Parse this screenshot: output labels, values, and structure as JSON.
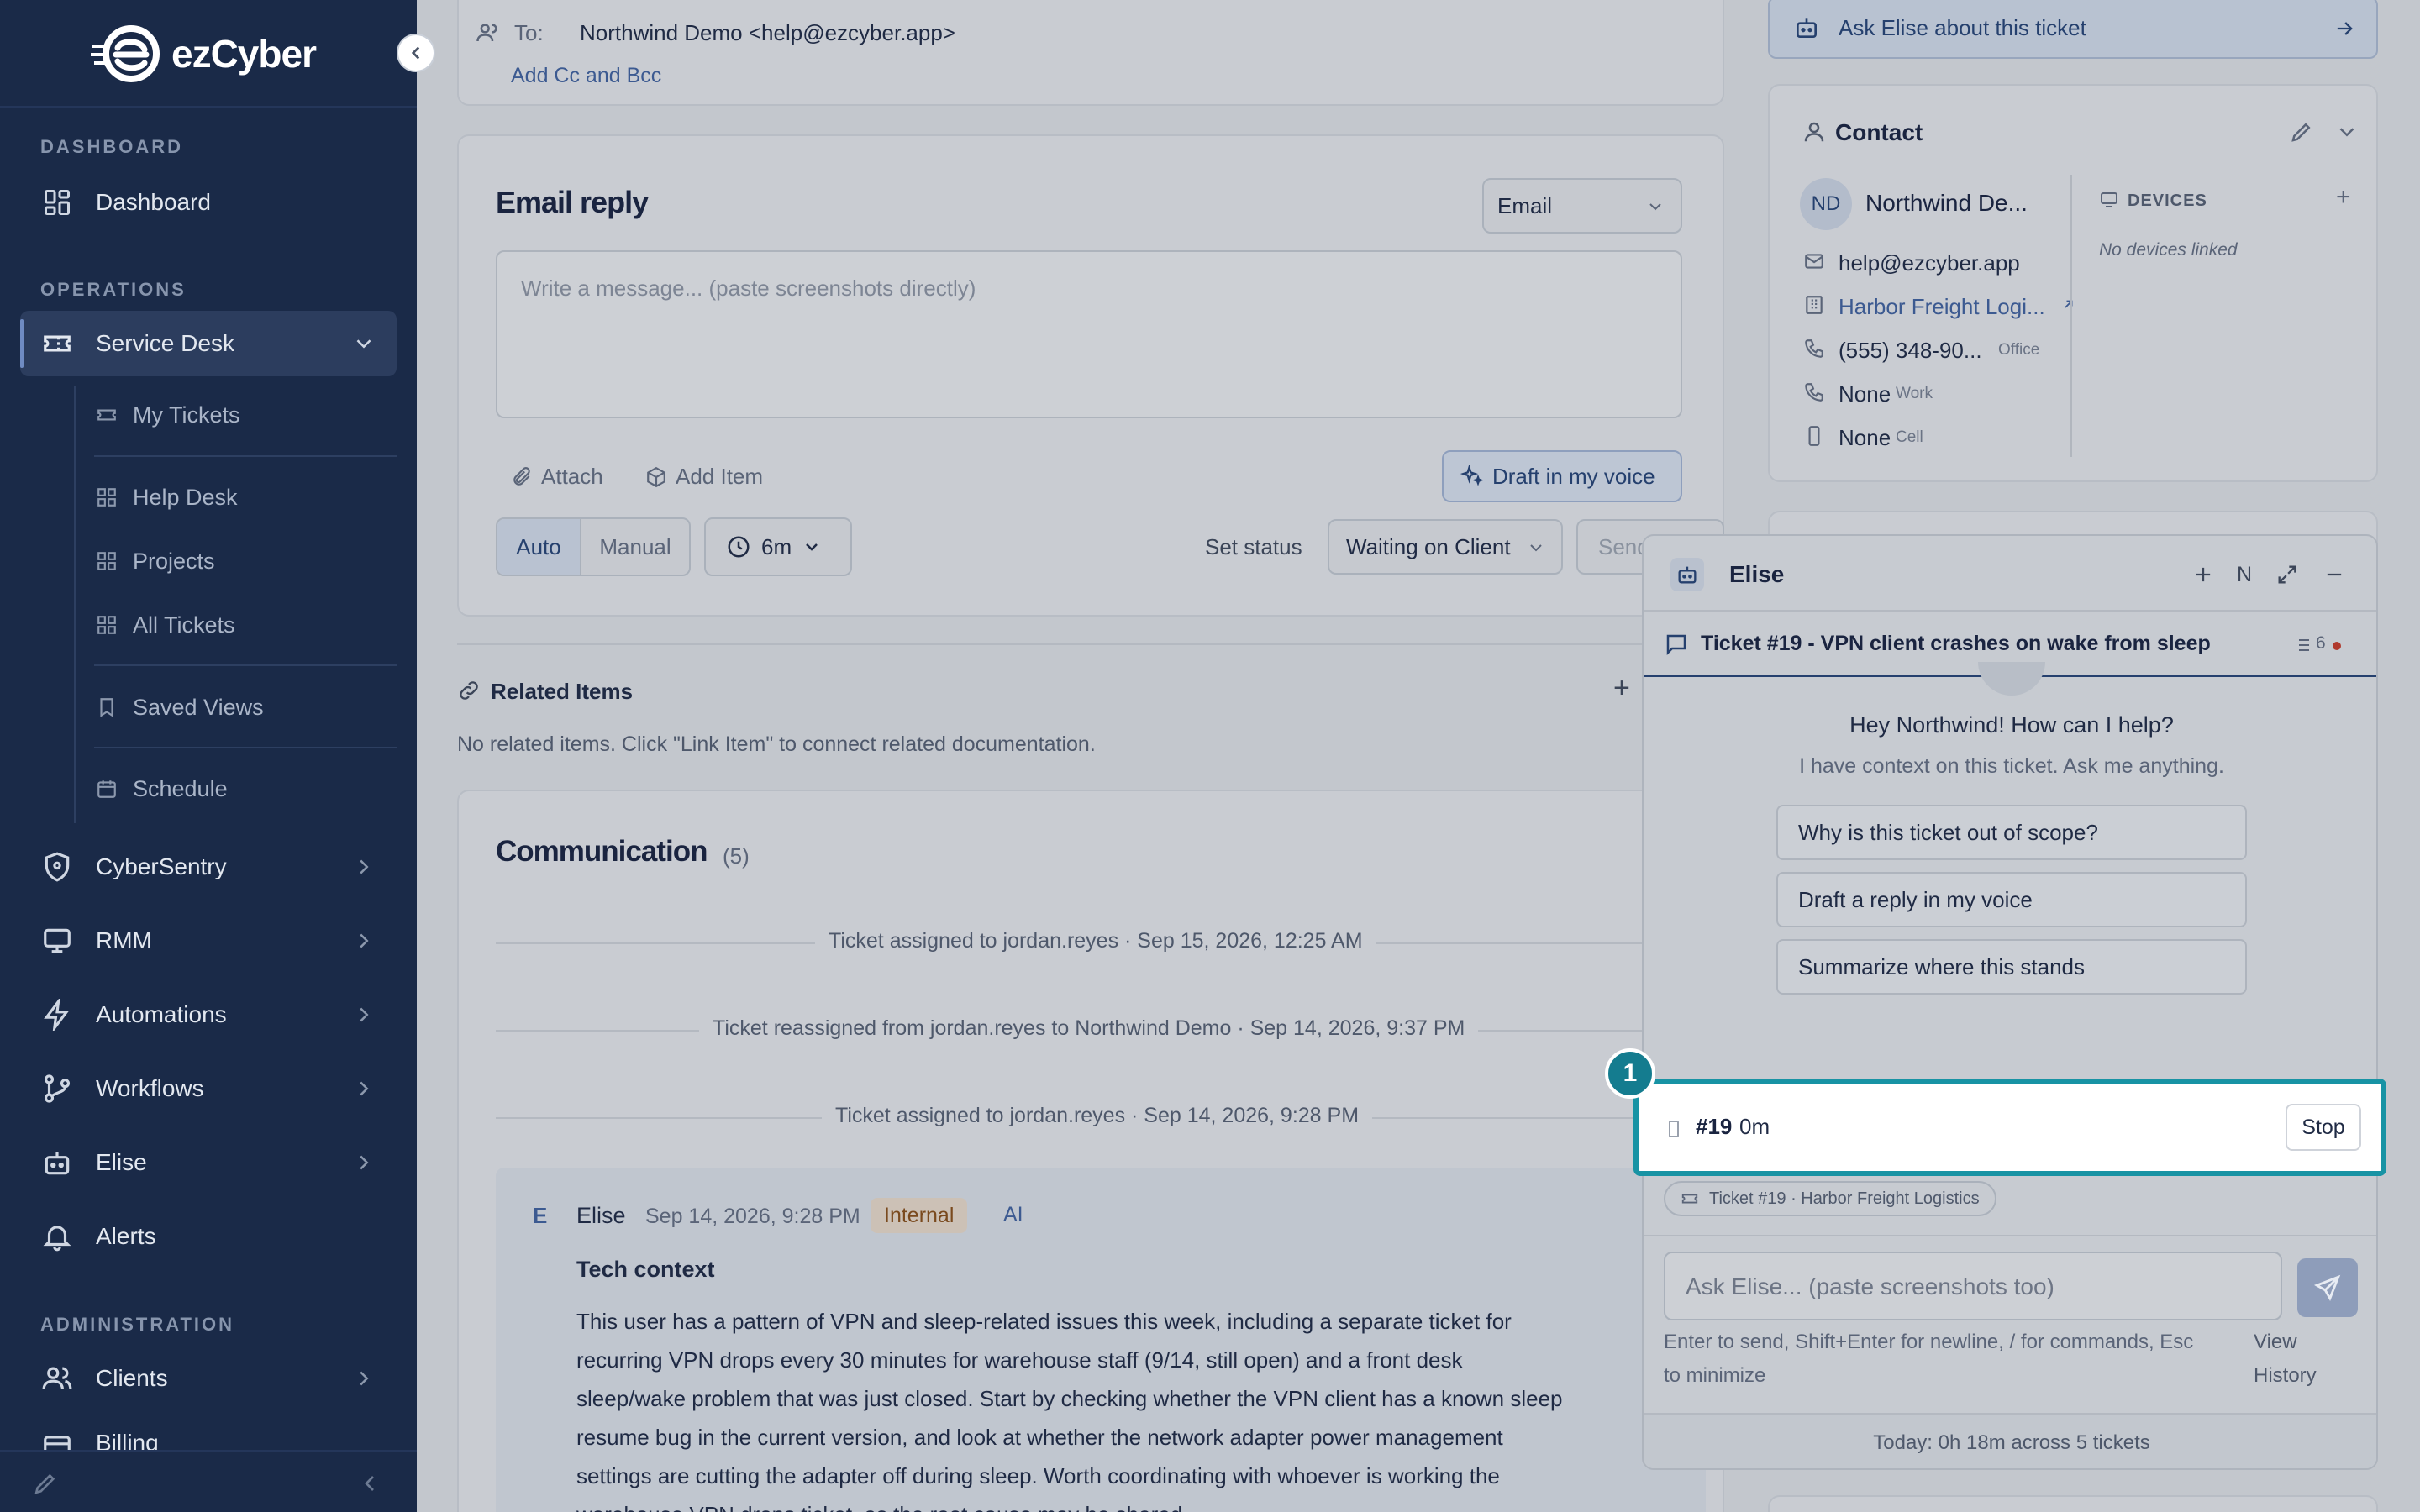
{
  "app": {
    "brand": "ezCyber",
    "accent": "#1893a4"
  },
  "sidebar": {
    "sections": {
      "dashboard": "DASHBOARD",
      "operations": "OPERATIONS",
      "administration": "ADMINISTRATION"
    },
    "dashboard": "Dashboard",
    "service_desk": "Service Desk",
    "sub": {
      "my_tickets": "My Tickets",
      "help_desk": "Help Desk",
      "projects": "Projects",
      "all_tickets": "All Tickets",
      "saved_views": "Saved Views",
      "schedule": "Schedule"
    },
    "cybersentry": "CyberSentry",
    "rmm": "RMM",
    "automations": "Automations",
    "workflows": "Workflows",
    "elise": "Elise",
    "alerts": "Alerts",
    "clients": "Clients",
    "billing": "Billing"
  },
  "email": {
    "to_label": "To:",
    "to_value": "Northwind Demo <help@ezcyber.app>",
    "add_cc": "Add Cc and Bcc"
  },
  "reply": {
    "title": "Email reply",
    "channel": "Email",
    "placeholder": "Write a message... (paste screenshots directly)",
    "attach": "Attach",
    "add_item": "Add Item",
    "draft": "Draft in my voice",
    "auto": "Auto",
    "manual": "Manual",
    "time": "6m",
    "set_status_label": "Set status",
    "status": "Waiting on Client",
    "send": "Send em"
  },
  "related": {
    "title": "Related Items",
    "add": "+",
    "empty": "No related items. Click \"Link Item\" to connect related documentation."
  },
  "communication": {
    "title": "Communication",
    "count": "(5)",
    "events": [
      "Ticket assigned to jordan.reyes · Sep 15, 2026, 12:25 AM",
      "Ticket reassigned from jordan.reyes to Northwind Demo · Sep 14, 2026, 9:37 PM",
      "Ticket assigned to jordan.reyes · Sep 14, 2026, 9:28 PM"
    ],
    "message": {
      "avatar": "E",
      "author": "Elise",
      "time": "Sep 14, 2026, 9:28 PM",
      "tag_internal": "Internal",
      "tag_ai": "AI",
      "heading": "Tech context",
      "lines": [
        "This user has a pattern of VPN and sleep-related issues this week, including a separate ticket for",
        "recurring VPN drops every 30 minutes for warehouse staff (9/14, still open) and a front desk",
        "sleep/wake problem that was just closed. Start by checking whether the VPN client has a known sleep",
        "resume bug in the current version, and look at whether the network adapter power management",
        "settings are cutting the adapter off during sleep. Worth coordinating with whoever is working the",
        "warehouse VPN drops ticket, as the root cause may be shared."
      ]
    }
  },
  "ask_elise": "Ask Elise about this ticket",
  "contact": {
    "title": "Contact",
    "initials": "ND",
    "name": "Northwind De...",
    "email": "help@ezcyber.app",
    "company": "Harbor Freight Logi...",
    "phone": "(555) 348-90...",
    "phone_type": "Office",
    "work": "None",
    "work_type": "Work",
    "cell": "None",
    "cell_type": "Cell",
    "devices_label": "DEVICES",
    "devices_add": "+",
    "devices_empty": "No devices linked"
  },
  "chat": {
    "title": "Elise",
    "header_n": "N",
    "ticket_title": "Ticket #19 - VPN client crashes on wake from sleep",
    "list_count": "6",
    "greeting": "Hey Northwind! How can I help?",
    "subtext": "I have context on this ticket. Ask me anything.",
    "suggestions": [
      "Why is this ticket out of scope?",
      "Draft a reply in my voice",
      "Summarize where this stands"
    ],
    "chip": "Ticket #19 · Harbor Freight Logistics",
    "input_placeholder": "Ask Elise... (paste screenshots too)",
    "help_line1": "Enter to send, Shift+Enter for newline, / for commands, Esc",
    "help_line2": "to minimize",
    "view_history_1": "View",
    "view_history_2": "History",
    "footer": "Today: 0h 18m across 5 tickets"
  },
  "timer": {
    "badge": "1",
    "ticket": "#19",
    "elapsed": "0m",
    "stop": "Stop"
  }
}
